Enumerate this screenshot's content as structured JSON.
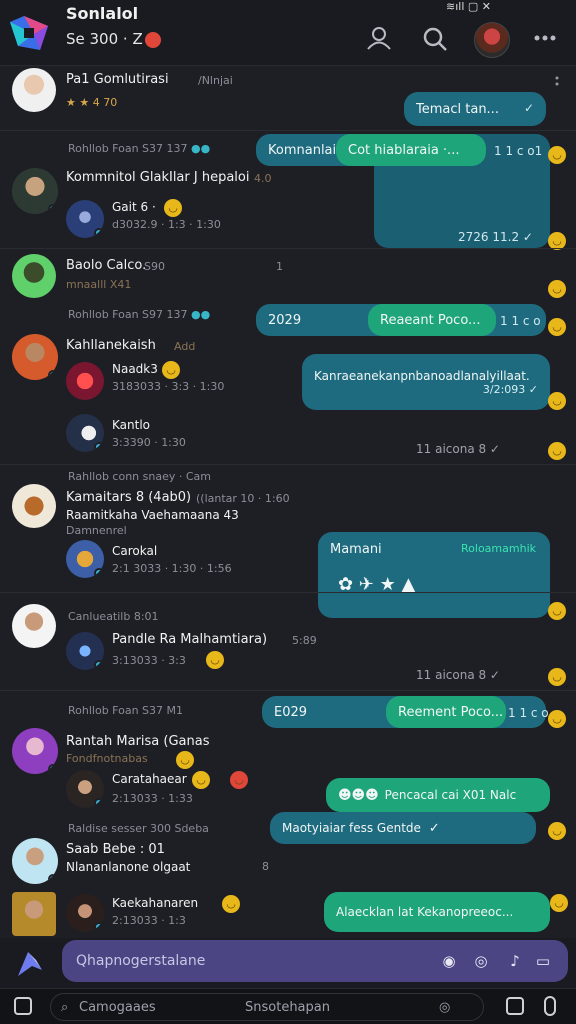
{
  "header": {
    "title": "Sonlalol",
    "subtitle": "Se 300 · Z",
    "status": "≋ıll ▢ ✕",
    "icons": [
      "contact-icon",
      "search-icon",
      "more-icon"
    ]
  },
  "rows": [
    {
      "name": "Pa1 Gomlutirasi",
      "handle": "/Nlnjai",
      "meta": "★ ★ 4 70"
    },
    {
      "section": "Rohllob Foan S37 137"
    },
    {
      "name": "Kommnitol GlakIlar J hepaloi",
      "handle": "4.0",
      "sub": "Gait 6 ·",
      "meta": "d3032.9 · 1:3 · 1:30"
    },
    {
      "name": "Baolo Calco.",
      "handle": "S90",
      "meta": "mnaalll X41",
      "count": "1"
    },
    {
      "section": "Rohllob Foan S97 137"
    },
    {
      "name": "Kahllanekaish",
      "handle": "Add",
      "sub": "Naadk3",
      "sub_meta": "3183033 · 3:3 · 1:30",
      "sub2": "Kantlo",
      "sub2_meta": "3:3390 · 1:30"
    },
    {
      "section": "Rahllob conn snaey · Cam"
    },
    {
      "name": "Kamaitars 8 (4ab0)",
      "handle": "((lantar 10 · 1:60",
      "line2": "Raamitkaha Vaehamaana 43",
      "line3": "Damnenrel",
      "sub": "Carokal",
      "sub_meta": "2:1 3033 · 1:30 · 1:56"
    },
    {
      "section": "Canlueatilb 8:01"
    },
    {
      "name": "Pandle Ra Malhamtiara)",
      "handle": "5:89",
      "sub_meta": "3:13033 · 3:3"
    },
    {
      "section": "Rohllob Foan S37 M1"
    },
    {
      "name": "Rantah Marisa (Ganas",
      "line2": "Fondfnotnabas",
      "sub": "Caratahaear",
      "sub_meta": "2:13033 · 1:33"
    },
    {
      "section": "Raldise sesser 300 Sdeba"
    },
    {
      "name": "Saab Bebe : 01",
      "line2": "Nlananlanone olgaat",
      "count": "8",
      "sub": "Kaekahanaren",
      "sub_meta": "2:13033 · 1:3"
    }
  ],
  "bubbles": [
    {
      "text": "Temacl tan...",
      "time": "✓"
    },
    {
      "text": "Komnanlai",
      "time": ""
    },
    {
      "text": "Cot hiablaraia ·...",
      "time": "1 1 c o1"
    },
    {
      "text": "",
      "time": "2726 11.2 ✓"
    },
    {
      "text": "2029",
      "time": ""
    },
    {
      "text": "Reaeant Poco...",
      "time": "1 1 c o"
    },
    {
      "text": "Kanraeanekanpnbanoadlanalyillaat.",
      "time": "3/2:093 ✓"
    },
    {
      "text": "",
      "time": "11 aicona 8 ✓"
    },
    {
      "text": "Mamani",
      "time": "Roloamamhik"
    },
    {
      "text": "",
      "time": "11 aicona 8 ✓"
    },
    {
      "text": "E029",
      "time": ""
    },
    {
      "text": "Reement Poco...",
      "time": "1 1 c o"
    },
    {
      "text": "Pencacal cai X01 Nalc",
      "time": ""
    },
    {
      "text": "Maotyiaiar fess Gentde",
      "time": "✓"
    },
    {
      "text": "Alaecklan lat Kekanopreeoc...",
      "time": ""
    }
  ],
  "composer": {
    "placeholder": "Qhapnogerstalane"
  },
  "bottom": {
    "left": "Camogaaes",
    "center": "Snsotehapan"
  },
  "colors": {
    "teal": "#1e6b7f",
    "green": "#1fa57a",
    "composer": "#4b4584",
    "bg": "#1e1f24"
  }
}
